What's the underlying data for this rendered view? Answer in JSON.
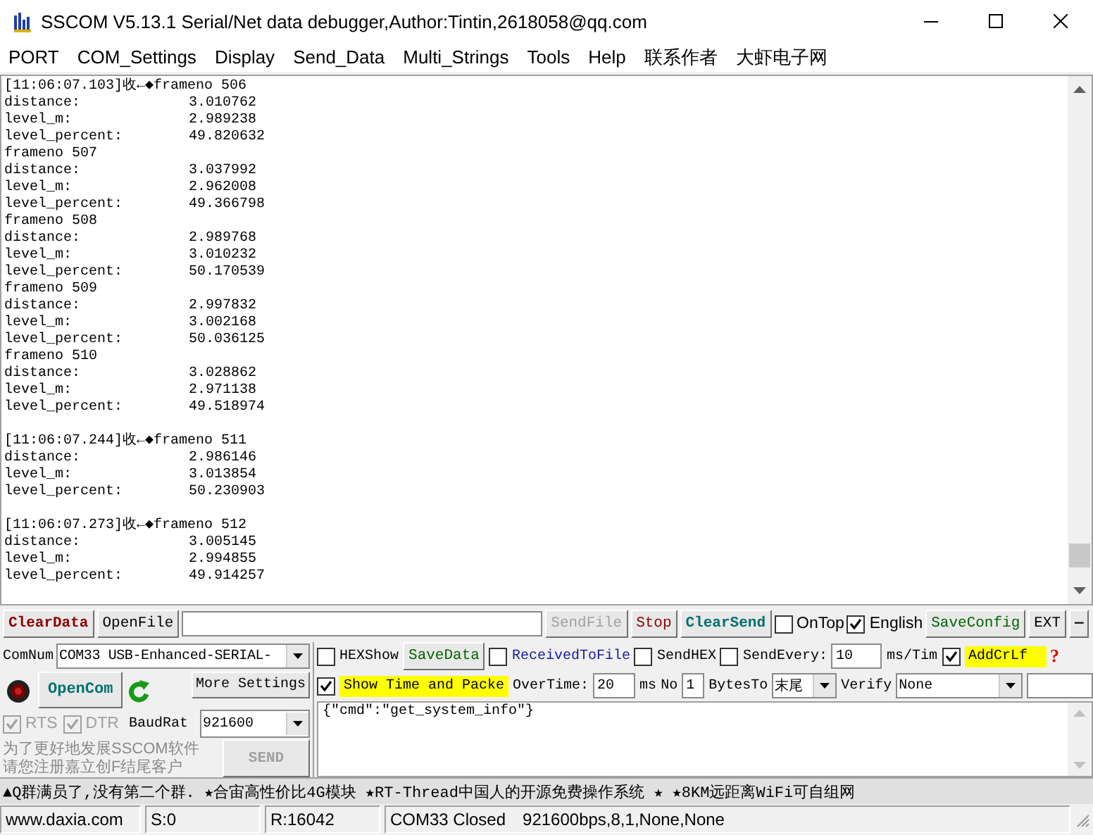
{
  "window": {
    "title": "SSCOM V5.13.1 Serial/Net data debugger,Author:Tintin,2618058@qq.com"
  },
  "menu": [
    "PORT",
    "COM_Settings",
    "Display",
    "Send_Data",
    "Multi_Strings",
    "Tools",
    "Help",
    "联系作者",
    "大虾电子网"
  ],
  "log": [
    {
      "kind": "line",
      "text": "[11:06:07.103]收←◆frameno 506"
    },
    {
      "kind": "field",
      "label": "distance:",
      "value": "3.010762"
    },
    {
      "kind": "field",
      "label": "level_m:",
      "value": "2.989238"
    },
    {
      "kind": "field",
      "label": "level_percent:",
      "value": "49.820632"
    },
    {
      "kind": "line",
      "text": "frameno 507"
    },
    {
      "kind": "field",
      "label": "distance:",
      "value": "3.037992"
    },
    {
      "kind": "field",
      "label": "level_m:",
      "value": "2.962008"
    },
    {
      "kind": "field",
      "label": "level_percent:",
      "value": "49.366798"
    },
    {
      "kind": "line",
      "text": "frameno 508"
    },
    {
      "kind": "field",
      "label": "distance:",
      "value": "2.989768"
    },
    {
      "kind": "field",
      "label": "level_m:",
      "value": "3.010232"
    },
    {
      "kind": "field",
      "label": "level_percent:",
      "value": "50.170539"
    },
    {
      "kind": "line",
      "text": "frameno 509"
    },
    {
      "kind": "field",
      "label": "distance:",
      "value": "2.997832"
    },
    {
      "kind": "field",
      "label": "level_m:",
      "value": "3.002168"
    },
    {
      "kind": "field",
      "label": "level_percent:",
      "value": "50.036125"
    },
    {
      "kind": "line",
      "text": "frameno 510"
    },
    {
      "kind": "field",
      "label": "distance:",
      "value": "3.028862"
    },
    {
      "kind": "field",
      "label": "level_m:",
      "value": "2.971138"
    },
    {
      "kind": "field",
      "label": "level_percent:",
      "value": "49.518974"
    },
    {
      "kind": "gap"
    },
    {
      "kind": "line",
      "text": "[11:06:07.244]收←◆frameno 511"
    },
    {
      "kind": "field",
      "label": "distance:",
      "value": "2.986146"
    },
    {
      "kind": "field",
      "label": "level_m:",
      "value": "3.013854"
    },
    {
      "kind": "field",
      "label": "level_percent:",
      "value": "50.230903"
    },
    {
      "kind": "gap"
    },
    {
      "kind": "line",
      "text": "[11:06:07.273]收←◆frameno 512"
    },
    {
      "kind": "field",
      "label": "distance:",
      "value": "3.005145"
    },
    {
      "kind": "field",
      "label": "level_m:",
      "value": "2.994855"
    },
    {
      "kind": "field",
      "label": "level_percent:",
      "value": "49.914257"
    }
  ],
  "send_toolbar": {
    "clear_data": "ClearData",
    "open_file": "OpenFile",
    "send_file": {
      "label": "SendFile",
      "disabled": true
    },
    "stop": "Stop",
    "clear_send": "ClearSend",
    "on_top": {
      "label": "OnTop",
      "checked": false
    },
    "english": {
      "label": "English",
      "checked": true
    },
    "save_config": "SaveConfig",
    "ext": "EXT",
    "collapse": "—"
  },
  "port_panel": {
    "com_label": "ComNum",
    "com_port": "COM33 USB-Enhanced-SERIAL-",
    "port_open": false,
    "open_com": "OpenCom",
    "more_settings": "More Settings",
    "rts": {
      "label": "RTS",
      "checked": true,
      "disabled": true
    },
    "dtr": {
      "label": "DTR",
      "checked": true,
      "disabled": true
    },
    "baud_label": "BaudRat",
    "baud_rate": "921600",
    "notice": [
      "为了更好地发展SSCOM软件",
      "请您注册嘉立创F结尾客户"
    ],
    "send": {
      "label": "SEND",
      "disabled": true
    }
  },
  "options": {
    "hex_show": {
      "label": "HEXShow",
      "checked": false
    },
    "save_data": "SaveData",
    "received_to_file": {
      "label": "ReceivedToFile",
      "checked": false
    },
    "send_hex": {
      "label": "SendHEX",
      "checked": false
    },
    "send_every": {
      "label": "SendEvery:",
      "checked": false
    },
    "interval": "10",
    "interval_unit": "ms/Tim",
    "add_crlf": {
      "label": "AddCrLf",
      "checked": true
    },
    "help": "?",
    "show_time": {
      "label": "Show Time and Packe",
      "checked": true
    },
    "overtime_label": "OverTime:",
    "overtime": "20",
    "overtime_unit": "ms",
    "no_label": "No",
    "no": "1",
    "bytes_to_label": "BytesTo",
    "bytes_to": "末尾",
    "verify_label": "Verify",
    "verify": "None"
  },
  "send_text": "{\"cmd\":\"get_system_info\"}",
  "ticker": "▲Q群满员了,没有第二个群. ★合宙高性价比4G模块 ★RT-Thread中国人的开源免费操作系统 ★ ★8KM远距离WiFi可自组网",
  "status_bar": {
    "website": "www.daxia.com",
    "sent": "S:0",
    "received": "R:16042",
    "port_state": "COM33 Closed",
    "port_settings": "921600bps,8,1,None,None"
  }
}
